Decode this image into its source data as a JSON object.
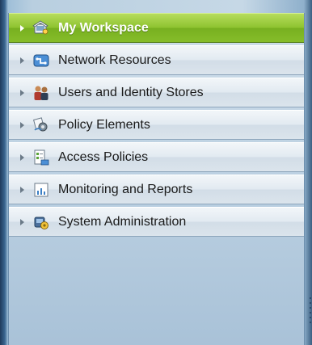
{
  "nav": {
    "items": [
      {
        "label": "My Workspace",
        "icon": "workspace-icon",
        "active": true
      },
      {
        "label": "Network Resources",
        "icon": "network-icon",
        "active": false
      },
      {
        "label": "Users and Identity Stores",
        "icon": "users-icon",
        "active": false
      },
      {
        "label": "Policy Elements",
        "icon": "policy-elements-icon",
        "active": false
      },
      {
        "label": "Access Policies",
        "icon": "access-policies-icon",
        "active": false
      },
      {
        "label": "Monitoring and Reports",
        "icon": "reports-icon",
        "active": false
      },
      {
        "label": "System Administration",
        "icon": "admin-icon",
        "active": false
      }
    ]
  },
  "colors": {
    "active_green": "#86bd2a",
    "panel_blue": "#bfd3e3",
    "text": "#1a1a1a"
  }
}
